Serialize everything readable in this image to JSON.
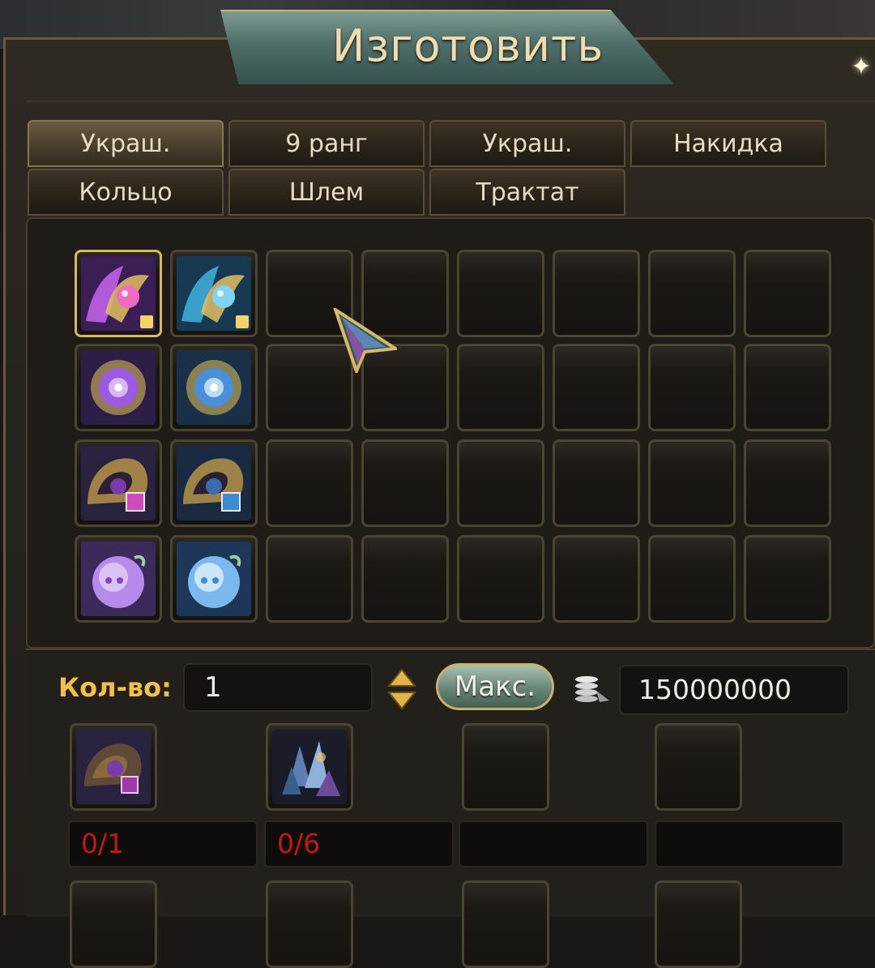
{
  "window": {
    "title": "Изготовить",
    "close_glyph": "✦"
  },
  "tabs": [
    {
      "label": "Украш.",
      "active": true
    },
    {
      "label": "9 ранг",
      "active": false
    },
    {
      "label": "Украш.",
      "active": false
    },
    {
      "label": "Накидка",
      "active": false
    },
    {
      "label": "Кольцо",
      "active": false
    },
    {
      "label": "Шлем",
      "active": false
    },
    {
      "label": "Трактат",
      "active": false
    }
  ],
  "grid": {
    "rows": 4,
    "columns": 8,
    "items": [
      {
        "row": 0,
        "col": 0,
        "icon": "purple-jewel-ornament-icon",
        "selected": true
      },
      {
        "row": 0,
        "col": 1,
        "icon": "blue-jewel-ornament-icon",
        "selected": false
      },
      {
        "row": 1,
        "col": 0,
        "icon": "purple-orb-icon",
        "selected": false
      },
      {
        "row": 1,
        "col": 1,
        "icon": "blue-orb-icon",
        "selected": false
      },
      {
        "row": 2,
        "col": 0,
        "icon": "purple-gold-crest-icon",
        "selected": false
      },
      {
        "row": 2,
        "col": 1,
        "icon": "blue-gold-crest-icon",
        "selected": false
      },
      {
        "row": 3,
        "col": 0,
        "icon": "purple-spirit-pearl-icon",
        "selected": false
      },
      {
        "row": 3,
        "col": 1,
        "icon": "blue-spirit-pearl-icon",
        "selected": false
      }
    ]
  },
  "craft": {
    "quantity_label": "Кол-во:",
    "quantity_value": "1",
    "max_button": "Макс.",
    "currency_icon": "silver-coins-icon",
    "cost": "150000000"
  },
  "materials": [
    {
      "icon": "purple-gold-crest-icon",
      "count": "0/1"
    },
    {
      "icon": "crystal-cluster-icon",
      "count": "0/6"
    },
    {
      "icon": "",
      "count": ""
    },
    {
      "icon": "",
      "count": ""
    }
  ],
  "colors": {
    "gold_accent": "#f2c04a",
    "insufficient_red": "#c11a10",
    "selected_border": "#d8b868",
    "purple": "#8b3fc8",
    "blue": "#3a8bd0"
  }
}
